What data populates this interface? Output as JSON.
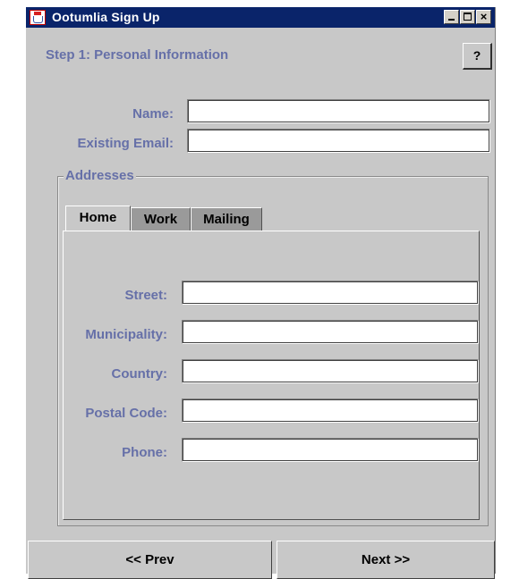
{
  "window": {
    "title": "Ootumlia Sign Up",
    "close_glyph": "×"
  },
  "header": {
    "step_title": "Step 1: Personal Information",
    "help_label": "?"
  },
  "personal": {
    "name_label": "Name:",
    "name_value": "",
    "email_label": "Existing Email:",
    "email_value": ""
  },
  "addresses": {
    "group_title": "Addresses",
    "tabs": [
      {
        "label": "Home",
        "active": true
      },
      {
        "label": "Work",
        "active": false
      },
      {
        "label": "Mailing",
        "active": false
      }
    ],
    "fields": [
      {
        "label": "Street:",
        "value": ""
      },
      {
        "label": "Municipality:",
        "value": ""
      },
      {
        "label": "Country:",
        "value": ""
      },
      {
        "label": "Postal Code:",
        "value": ""
      },
      {
        "label": "Phone:",
        "value": ""
      }
    ]
  },
  "footer": {
    "prev_label": "<< Prev",
    "next_label": "Next >>"
  },
  "icons": {
    "app": "coffee-cup-icon",
    "minimize": "minimize-icon",
    "maximize": "maximize-icon",
    "close": "close-icon"
  },
  "colors": {
    "titlebar": "#0a246a",
    "window_bg": "#c8c8c8",
    "label_text": "#6670a8",
    "inactive_tab": "#9a9a9a"
  }
}
